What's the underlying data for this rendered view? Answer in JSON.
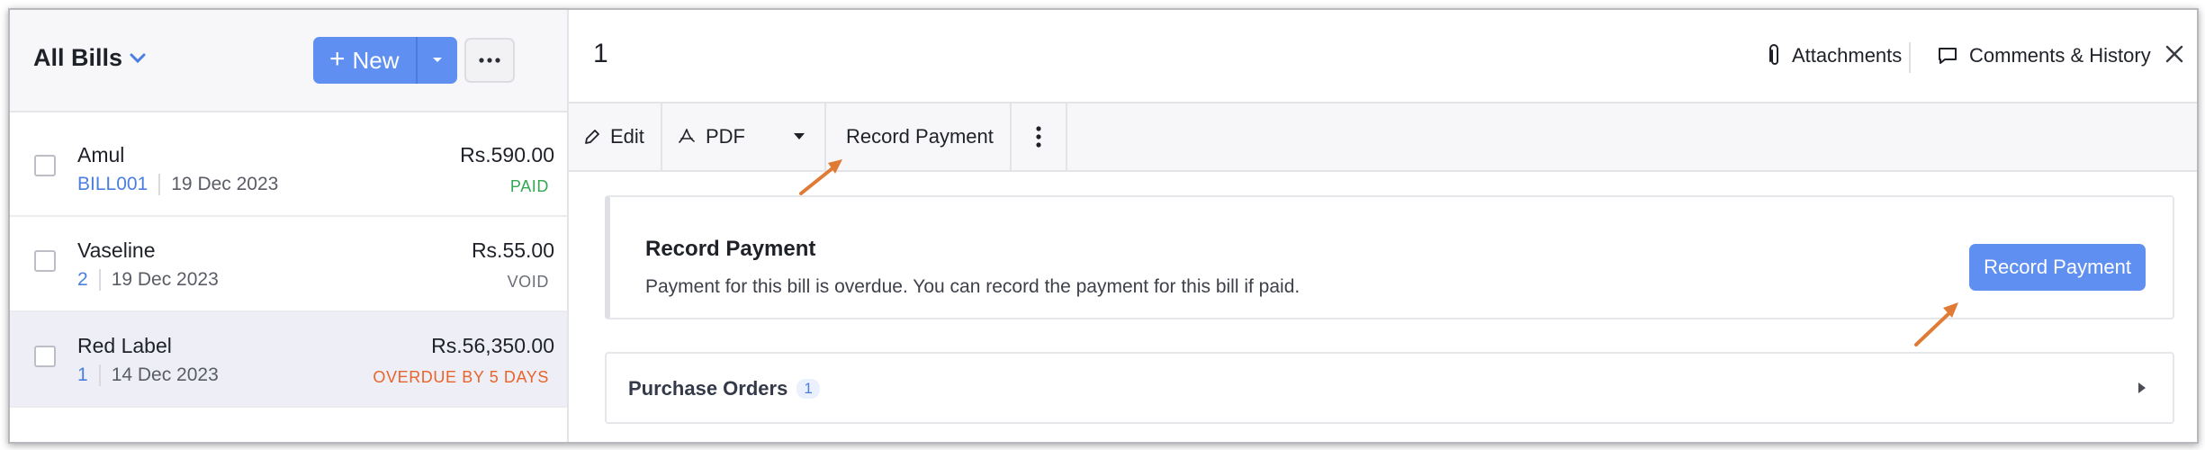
{
  "sidebar": {
    "view_title": "All Bills",
    "new_button": {
      "label": "New"
    },
    "bills": [
      {
        "vendor": "Amul",
        "number": "BILL001",
        "date": "19 Dec 2023",
        "amount": "Rs.590.00",
        "status": "PAID",
        "status_color": "#34a853"
      },
      {
        "vendor": "Vaseline",
        "number": "2",
        "date": "19 Dec 2023",
        "amount": "Rs.55.00",
        "status": "VOID",
        "status_color": "#6b6e76"
      },
      {
        "vendor": "Red Label",
        "number": "1",
        "date": "14 Dec 2023",
        "amount": "Rs.56,350.00",
        "status": "OVERDUE BY 5 DAYS",
        "status_color": "#e8642b",
        "selected": true
      }
    ]
  },
  "detail": {
    "title": "1",
    "attachments_label": "Attachments",
    "comments_label": "Comments & History",
    "toolbar": {
      "edit_label": "Edit",
      "pdf_label": "PDF",
      "record_payment_label": "Record Payment"
    },
    "banner": {
      "title": "Record Payment",
      "text": "Payment for this bill is overdue. You can record the payment for this bill if paid.",
      "button_label": "Record Payment"
    },
    "purchase_orders": {
      "label": "Purchase Orders",
      "count": "1"
    }
  },
  "colors": {
    "accent": "#5f8ff0",
    "link": "#4a7fe0",
    "annotation_arrow": "#e07b35",
    "overdue": "#e8642b",
    "paid": "#34a853"
  }
}
